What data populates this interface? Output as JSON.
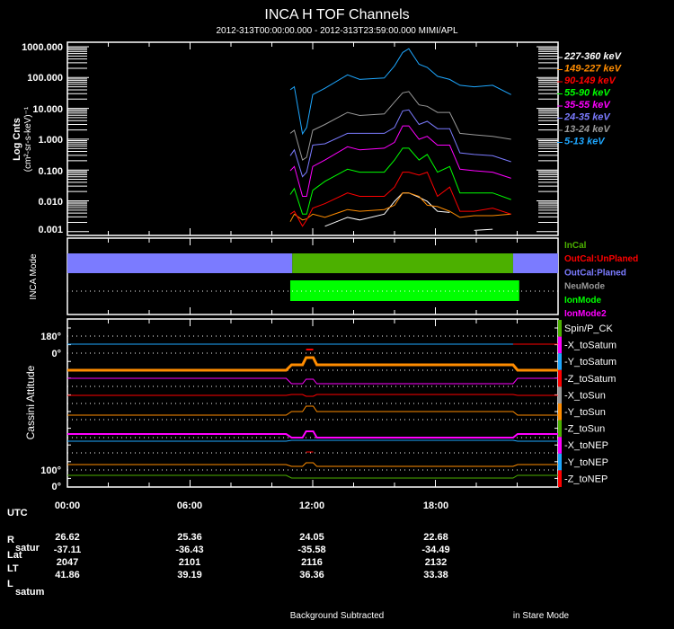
{
  "header": {
    "title": "INCA H TOF Channels",
    "subtitle": "2012-313T00:00:00.000 - 2012-313T23:59:00.000 MIMI/APL"
  },
  "chart_data": [
    {
      "type": "line",
      "ylabel": "Log Cnts",
      "ylabel_units": "(cm²-sr-s-keV)⁻¹",
      "yscale": "log",
      "ylim": [
        0.001,
        1000
      ],
      "yticks": [
        "1000.000",
        "100.000",
        "10.000",
        "1.000",
        "0.100",
        "0.010",
        "0.001"
      ],
      "xlim_hours": [
        0,
        24
      ],
      "x_hours": [
        10.9,
        11.1,
        11.5,
        11.7,
        12.0,
        12.6,
        13.7,
        14.3,
        15.5,
        16.0,
        16.4,
        16.7,
        17.2,
        17.6,
        18.1,
        18.7,
        19.2,
        19.9,
        20.8,
        21.7
      ],
      "legend_position": "right",
      "series": [
        {
          "name": "227-360 keV",
          "color": "#ffffff",
          "values": [
            null,
            null,
            null,
            null,
            null,
            0.0015,
            0.0029,
            0.0024,
            0.0037,
            0.0096,
            0.018,
            0.018,
            0.013,
            0.0096,
            0.0046,
            0.0042,
            null,
            0.0011,
            0.0012,
            null
          ]
        },
        {
          "name": "149-227 keV",
          "color": "#ff8c00",
          "values": [
            0.0021,
            0.0037,
            0.0024,
            0.0026,
            0.0037,
            0.0029,
            0.0052,
            0.0046,
            0.0052,
            0.0072,
            0.018,
            0.018,
            0.014,
            0.0072,
            0.0065,
            0.0046,
            0.0029,
            0.0033,
            0.0033,
            0.0037
          ]
        },
        {
          "name": "90-149 keV",
          "color": "#ff0000",
          "values": [
            0.0037,
            0.0046,
            0.0015,
            0.0024,
            0.0058,
            0.0081,
            0.018,
            0.014,
            0.014,
            0.028,
            0.085,
            0.085,
            0.068,
            0.085,
            0.014,
            0.028,
            0.0046,
            0.0046,
            0.0058,
            0.0037
          ]
        },
        {
          "name": "55-90 keV",
          "color": "#00ff00",
          "values": [
            0.016,
            0.025,
            0.0037,
            0.0037,
            0.022,
            0.043,
            0.106,
            0.085,
            0.085,
            0.21,
            0.51,
            0.51,
            0.21,
            0.32,
            0.085,
            0.13,
            0.018,
            0.018,
            0.018,
            0.011
          ]
        },
        {
          "name": "35-55 keV",
          "color": "#ff00ff",
          "values": [
            0.095,
            0.13,
            0.014,
            0.014,
            0.13,
            0.21,
            0.57,
            0.45,
            0.51,
            0.79,
            2.7,
            2.7,
            0.99,
            1.24,
            0.64,
            0.64,
            0.106,
            0.095,
            0.085,
            0.054
          ]
        },
        {
          "name": "24-35 keV",
          "color": "#7b7bff",
          "values": [
            0.29,
            0.45,
            0.061,
            0.085,
            0.64,
            0.71,
            1.55,
            1.55,
            1.55,
            2.4,
            8.3,
            8.9,
            3.0,
            3.8,
            2.2,
            2.2,
            0.36,
            0.32,
            0.29,
            0.185
          ]
        },
        {
          "name": "13-24 keV",
          "color": "#999999",
          "values": [
            1.55,
            1.95,
            0.21,
            0.26,
            1.95,
            3.0,
            7.4,
            5.9,
            6.6,
            16,
            32,
            35,
            13,
            11.7,
            7.4,
            7.4,
            1.55,
            1.39,
            1.24,
            0.99
          ]
        },
        {
          "name": "5-13 keV",
          "color": "#1ea7ff",
          "values": [
            40,
            50,
            1.5,
            2.4,
            28,
            45,
            122,
            87,
            97,
            240,
            650,
            860,
            270,
            213,
            110,
            87,
            56,
            50,
            56,
            28
          ]
        }
      ]
    },
    {
      "type": "bar",
      "ylabel": "INCA Mode",
      "legend_position": "right",
      "legend": [
        {
          "name": "InCal",
          "color": "#4cb000"
        },
        {
          "name": "OutCal:UnPlaned",
          "color": "#ff0000"
        },
        {
          "name": "OutCal:Planed",
          "color": "#7b7bff"
        },
        {
          "name": "NeuMode",
          "color": "#999999"
        },
        {
          "name": "IonMode",
          "color": "#00ff00"
        },
        {
          "name": "IonMode2",
          "color": "#ff00ff"
        }
      ],
      "intervals": [
        {
          "mode": "OutCal:Planed",
          "start_hour": 0,
          "end_hour": 11.0
        },
        {
          "mode": "InCal",
          "start_hour": 11.0,
          "end_hour": 21.8
        },
        {
          "mode": "OutCal:Planed",
          "start_hour": 21.8,
          "end_hour": 24
        },
        {
          "mode": "IonMode",
          "start_hour": 10.9,
          "end_hour": 22.1
        }
      ]
    },
    {
      "type": "line",
      "ylabel": "Cassini Attitude",
      "yticks": [
        "180°",
        "0°",
        "100°",
        "0°"
      ],
      "legend_position": "right",
      "legend": [
        {
          "name": "Spin/P_CK",
          "color": "#4cb000"
        },
        {
          "name": "-X_toSatum",
          "color": "#ff00ff"
        },
        {
          "name": "-Y_toSatum",
          "color": "#1ea7ff"
        },
        {
          "name": "-Z_toSatum",
          "color": "#ff0000"
        },
        {
          "name": "-X_toSun",
          "color": "#999999"
        },
        {
          "name": "-Y_toSun",
          "color": "#ff8c00"
        },
        {
          "name": "-Z_toSun",
          "color": "#4cb000"
        },
        {
          "name": "-X_toNEP",
          "color": "#ff00ff"
        },
        {
          "name": "-Y_toNEP",
          "color": "#1ea7ff"
        },
        {
          "name": "-Z_toNEP",
          "color": "#ff0000"
        }
      ]
    }
  ],
  "ephemeris": {
    "utc_label": "UTC",
    "times": [
      "00:00",
      "06:00",
      "12:00",
      "18:00"
    ],
    "rows": [
      {
        "label": "R",
        "sub": "satur",
        "values": [
          "26.62",
          "25.36",
          "24.05",
          "22.68"
        ]
      },
      {
        "label": "Lat",
        "sub": "",
        "values": [
          "-37.11",
          "-36.43",
          "-35.58",
          "-34.49"
        ]
      },
      {
        "label": "LT",
        "sub": "",
        "values": [
          "2047",
          "2101",
          "2116",
          "2132"
        ]
      },
      {
        "label": "L",
        "sub": "satum",
        "values": [
          "41.86",
          "39.19",
          "36.36",
          "33.38"
        ]
      }
    ]
  },
  "footer": {
    "left": "Background Subtracted",
    "right": "in Stare Mode"
  }
}
